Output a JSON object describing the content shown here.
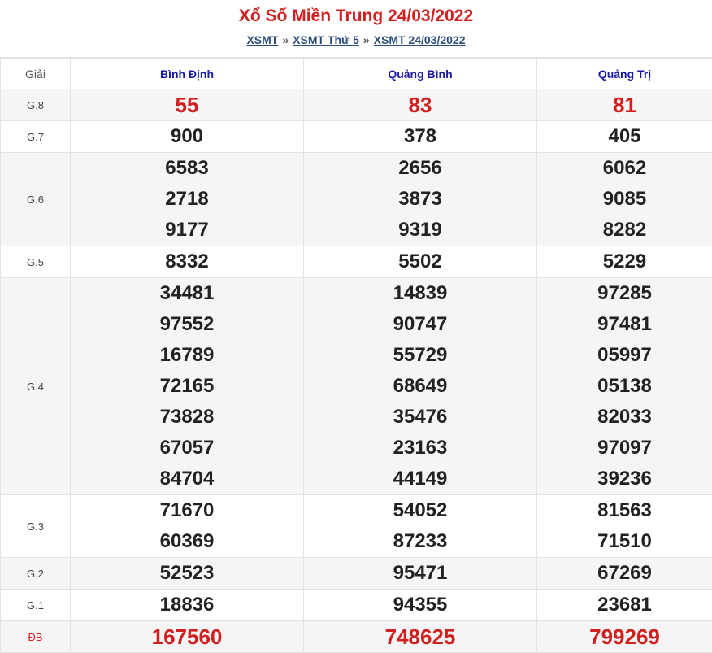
{
  "title": "Xổ Số Miền Trung 24/03/2022",
  "breadcrumb": {
    "items": [
      "XSMT",
      "XSMT Thứ 5",
      "XSMT 24/03/2022"
    ],
    "separator": "»"
  },
  "table": {
    "header": {
      "giai": "Giải",
      "provinces": [
        "Bình Định",
        "Quảng Bình",
        "Quảng Trị"
      ]
    },
    "rows": [
      {
        "label": "G.8",
        "values": [
          [
            "55"
          ],
          [
            "83"
          ],
          [
            "81"
          ]
        ]
      },
      {
        "label": "G.7",
        "values": [
          [
            "900"
          ],
          [
            "378"
          ],
          [
            "405"
          ]
        ]
      },
      {
        "label": "G.6",
        "values": [
          [
            "6583",
            "2718",
            "9177"
          ],
          [
            "2656",
            "3873",
            "9319"
          ],
          [
            "6062",
            "9085",
            "8282"
          ]
        ]
      },
      {
        "label": "G.5",
        "values": [
          [
            "8332"
          ],
          [
            "5502"
          ],
          [
            "5229"
          ]
        ]
      },
      {
        "label": "G.4",
        "values": [
          [
            "34481",
            "97552",
            "16789",
            "72165",
            "73828",
            "67057",
            "84704"
          ],
          [
            "14839",
            "90747",
            "55729",
            "68649",
            "35476",
            "23163",
            "44149"
          ],
          [
            "97285",
            "97481",
            "05997",
            "05138",
            "82033",
            "97097",
            "39236"
          ]
        ]
      },
      {
        "label": "G.3",
        "values": [
          [
            "71670",
            "60369"
          ],
          [
            "54052",
            "87233"
          ],
          [
            "81563",
            "71510"
          ]
        ]
      },
      {
        "label": "G.2",
        "values": [
          [
            "52523"
          ],
          [
            "95471"
          ],
          [
            "67269"
          ]
        ]
      },
      {
        "label": "G.1",
        "values": [
          [
            "18836"
          ],
          [
            "94355"
          ],
          [
            "23681"
          ]
        ]
      },
      {
        "label": "ĐB",
        "values": [
          [
            "167560"
          ],
          [
            "748625"
          ],
          [
            "799269"
          ]
        ]
      }
    ]
  },
  "colors": {
    "title": "#d0201f",
    "province_header": "#1a1aa6",
    "link": "#2c4e7e",
    "special_prize": "#d0201f",
    "stripe": "#f5f5f5"
  }
}
